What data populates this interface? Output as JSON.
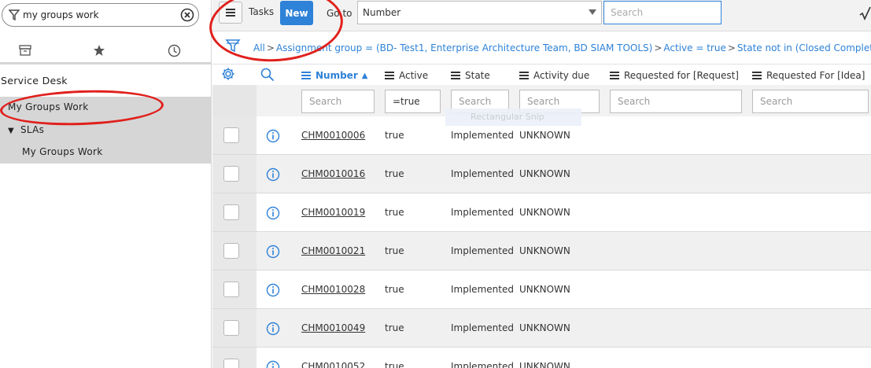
{
  "nav": {
    "filter_value": "my groups work",
    "items": [
      {
        "label": "Service Desk"
      },
      {
        "label": "My Groups Work"
      },
      {
        "label": "SLAs"
      },
      {
        "label": "My Groups Work"
      }
    ]
  },
  "header": {
    "tasks_label": "Tasks",
    "new_label": "New",
    "goto_label": "Go to",
    "field_select": "Number",
    "search_placeholder": "Search"
  },
  "breadcrumb": {
    "all": "All",
    "items": [
      "Assignment group = (BD- Test1, Enterprise Architecture Team, BD SIAM TOOLS)",
      "Active = true",
      "State not in (Closed Complete, Closed Incomplete"
    ],
    "separator": ">"
  },
  "columns": [
    {
      "label": "Number",
      "sorted": "ascending"
    },
    {
      "label": "Active"
    },
    {
      "label": "State"
    },
    {
      "label": "Activity due"
    },
    {
      "label": "Requested for [Request]"
    },
    {
      "label": "Requested For [Idea]"
    }
  ],
  "filters": {
    "placeholder": "Search",
    "active_value": "=true"
  },
  "ghost_text": "Rectangular Snip",
  "rows": [
    {
      "number": "CHM0010006",
      "active": "true",
      "state": "Implemented",
      "activity_due": "UNKNOWN"
    },
    {
      "number": "CHM0010016",
      "active": "true",
      "state": "Implemented",
      "activity_due": "UNKNOWN"
    },
    {
      "number": "CHM0010019",
      "active": "true",
      "state": "Implemented",
      "activity_due": "UNKNOWN"
    },
    {
      "number": "CHM0010021",
      "active": "true",
      "state": "Implemented",
      "activity_due": "UNKNOWN"
    },
    {
      "number": "CHM0010028",
      "active": "true",
      "state": "Implemented",
      "activity_due": "UNKNOWN"
    },
    {
      "number": "CHM0010049",
      "active": "true",
      "state": "Implemented",
      "activity_due": "UNKNOWN"
    },
    {
      "number": "CHM0010052",
      "active": "true",
      "state": "Implemented",
      "activity_due": "UNKNOWN"
    }
  ],
  "colors": {
    "accent": "#2e82d8",
    "annotation": "#e0201c",
    "selected_nav": "#d6d6d6"
  }
}
